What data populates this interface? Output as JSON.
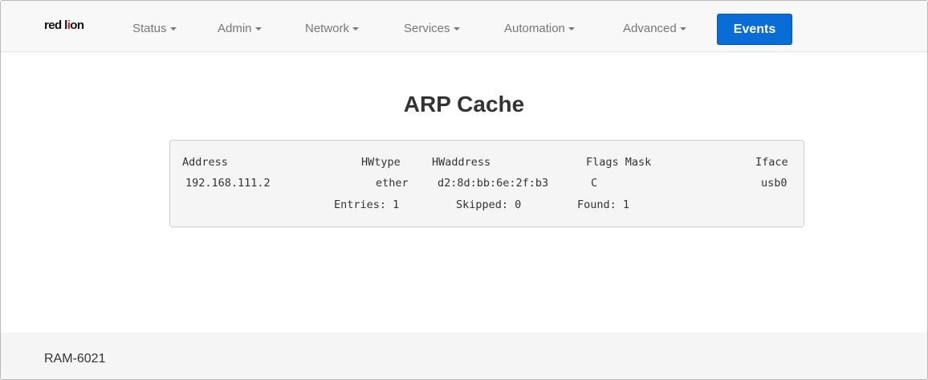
{
  "brand": {
    "logo_text_a": "red l",
    "logo_text_b": "i",
    "logo_text_c": "on"
  },
  "nav": {
    "items": [
      {
        "label": "Status"
      },
      {
        "label": "Admin"
      },
      {
        "label": "Network"
      },
      {
        "label": "Services"
      },
      {
        "label": "Automation"
      },
      {
        "label": "Advanced"
      }
    ],
    "events_label": "Events"
  },
  "page": {
    "title": "ARP Cache"
  },
  "arp": {
    "headers": {
      "address": "Address",
      "hwtype": "HWtype",
      "hwaddress": "HWaddress",
      "flags_mask": "Flags Mask",
      "iface": "Iface"
    },
    "rows": [
      {
        "address": "192.168.111.2",
        "hwtype": "ether",
        "hwaddress": "d2:8d:bb:6e:2f:b3",
        "flags": "C",
        "iface": "usb0"
      }
    ],
    "summary": {
      "entries": "Entries: 1",
      "skipped": "Skipped: 0",
      "found": "Found: 1"
    }
  },
  "footer": {
    "model": "RAM-6021"
  },
  "colors": {
    "events_button": "#0a6dd6",
    "logo_accent": "#cc1f2d"
  }
}
